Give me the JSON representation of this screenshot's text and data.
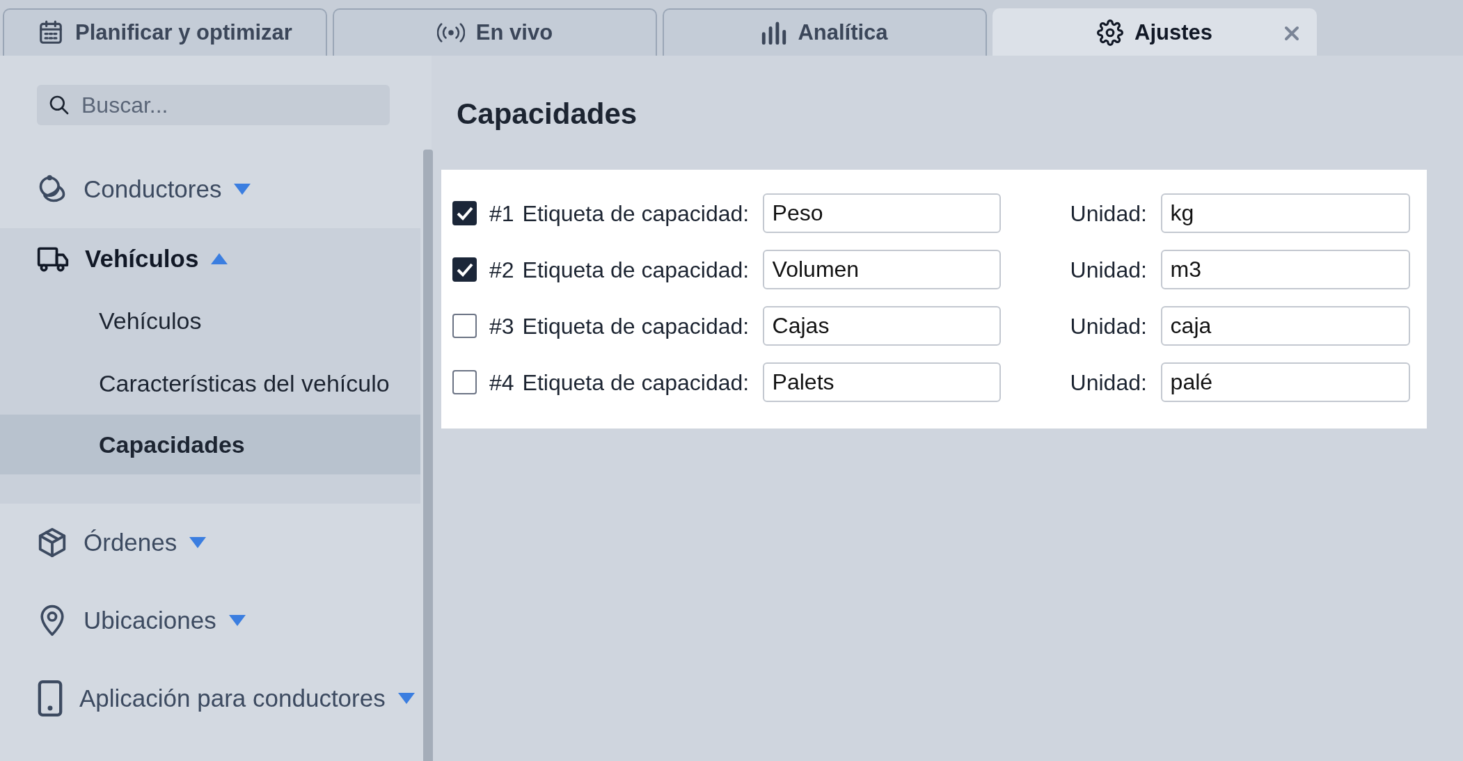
{
  "tabs": [
    {
      "label": "Planificar y optimizar",
      "selected": false,
      "closable": false
    },
    {
      "label": "En vivo",
      "selected": false,
      "closable": false
    },
    {
      "label": "Analítica",
      "selected": false,
      "closable": false
    },
    {
      "label": "Ajustes",
      "selected": true,
      "closable": true
    }
  ],
  "sidebar": {
    "search": {
      "placeholder": "Buscar..."
    },
    "items": [
      {
        "label": "Conductores",
        "expanded": false
      },
      {
        "label": "Vehículos",
        "expanded": true,
        "children": [
          {
            "label": "Vehículos",
            "selected": false
          },
          {
            "label": "Características del vehículo",
            "selected": false
          },
          {
            "label": "Capacidades",
            "selected": true
          }
        ]
      },
      {
        "label": "Órdenes",
        "expanded": false
      },
      {
        "label": "Ubicaciones",
        "expanded": false
      },
      {
        "label": "Aplicación para conductores",
        "expanded": false
      }
    ]
  },
  "content": {
    "title": "Capacidades",
    "rows": [
      {
        "checked": true,
        "number": "#1",
        "label": "Etiqueta de capacidad:",
        "value": "Peso",
        "unit_label": "Unidad:",
        "unit": "kg"
      },
      {
        "checked": true,
        "number": "#2",
        "label": "Etiqueta de capacidad:",
        "value": "Volumen",
        "unit_label": "Unidad:",
        "unit": "m3"
      },
      {
        "checked": false,
        "number": "#3",
        "label": "Etiqueta de capacidad:",
        "value": "Cajas",
        "unit_label": "Unidad:",
        "unit": "caja"
      },
      {
        "checked": false,
        "number": "#4",
        "label": "Etiqueta de capacidad:",
        "value": "Palets",
        "unit_label": "Unidad:",
        "unit": "palé"
      }
    ]
  }
}
